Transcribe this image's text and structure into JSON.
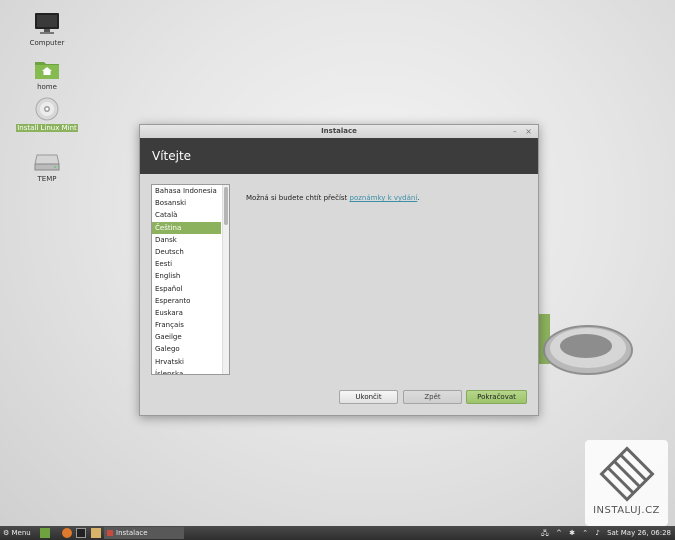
{
  "desktop": {
    "icons": [
      {
        "label": "Computer"
      },
      {
        "label": "home"
      },
      {
        "label": "Install Linux Mint"
      },
      {
        "label": "TEMP"
      }
    ]
  },
  "window": {
    "title": "Instalace",
    "controls": {
      "minimize": "–",
      "close": "×"
    },
    "header": "Vítejte",
    "languages": [
      "Bahasa Indonesia",
      "Bosanski",
      "Català",
      "Čeština",
      "Dansk",
      "Deutsch",
      "Eesti",
      "English",
      "Español",
      "Esperanto",
      "Euskara",
      "Français",
      "Gaeilge",
      "Galego",
      "Hrvatski",
      "Íslenska"
    ],
    "selected_language": "Čeština",
    "release_text": "Možná si budete chtít přečíst ",
    "release_link": "poznámky k vydání",
    "release_suffix": ".",
    "buttons": {
      "quit": "Ukončit",
      "back": "Zpět",
      "continue": "Pokračovat"
    }
  },
  "taskbar": {
    "menu_label": "Menu",
    "task_label": "Instalace",
    "clock": "Sat May 26, 06:28"
  },
  "watermark": {
    "text": "INSTALUJ.CZ"
  },
  "colors": {
    "accent": "#8cb25e",
    "header": "#3c3c3c",
    "link": "#3d8fa8"
  }
}
